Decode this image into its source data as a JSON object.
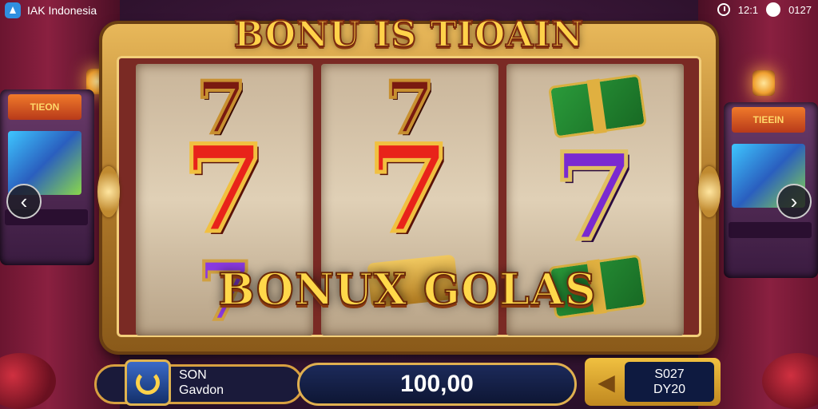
{
  "status_bar": {
    "app_name": "IAK Indonesia",
    "time": "12:1",
    "battery": "0127"
  },
  "game": {
    "headline": "BONU IS TIOAIN",
    "bonus_banner": "BONUX GOLAS",
    "reels": [
      {
        "symbols": [
          "seven-dark",
          "seven-red",
          "seven-purple"
        ]
      },
      {
        "symbols": [
          "seven-dark",
          "seven-red",
          "gold-bar"
        ]
      },
      {
        "symbols": [
          "cash",
          "seven-purple",
          "cash"
        ]
      }
    ],
    "arcade_left_label": "TIEON",
    "arcade_right_label": "TIEEIN"
  },
  "bottom": {
    "left_line1": "SON",
    "left_line2": "Gavdon",
    "amount": "100,00",
    "right_line1": "S027",
    "right_line2": "DY20"
  },
  "glyphs": {
    "seven": "7",
    "arrow_left": "‹",
    "arrow_right": "›",
    "back": "◀"
  },
  "colors": {
    "gold": "#ffd24a",
    "frame": "#c08a30",
    "red_seven": "#e8231a",
    "purple_seven": "#7a2ad0"
  }
}
